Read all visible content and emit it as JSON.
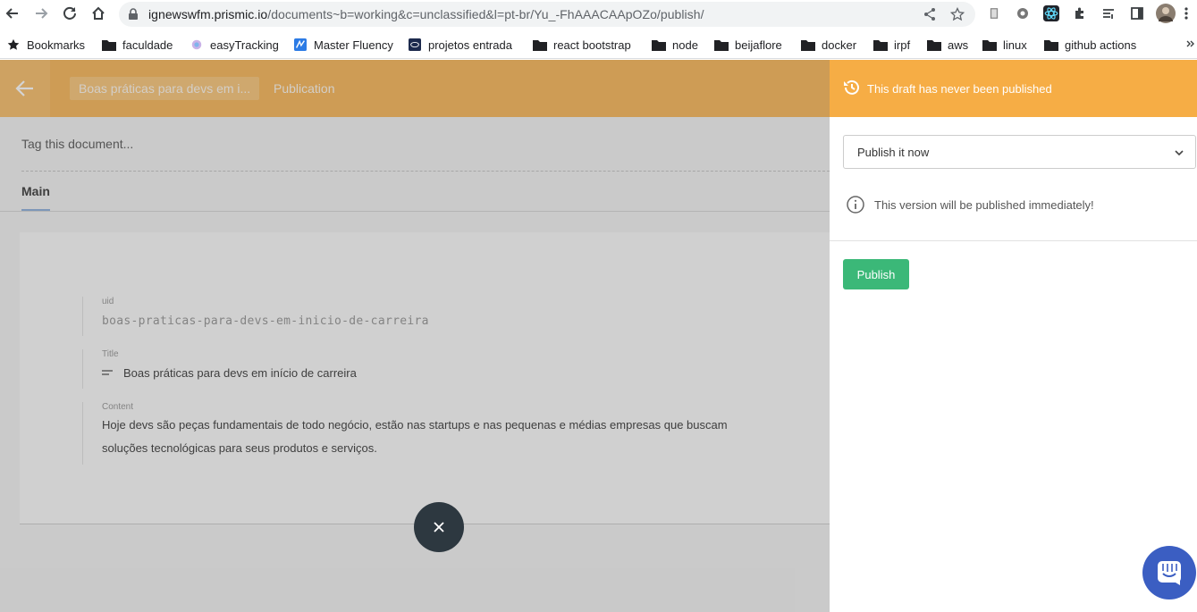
{
  "browser": {
    "url_host": "ignewswfm.prismic.io",
    "url_path": "/documents~b=working&c=unclassified&l=pt-br/Yu_-FhAAACAApOZo/publish/"
  },
  "bookmarks": [
    {
      "label": "Bookmarks",
      "icon": "star-icon"
    },
    {
      "label": "faculdade",
      "icon": "folder-icon"
    },
    {
      "label": "easyTracking",
      "icon": "app-icon"
    },
    {
      "label": "Master Fluency",
      "icon": "app-icon"
    },
    {
      "label": "projetos entrada",
      "icon": "app-icon"
    },
    {
      "label": "react bootstrap",
      "icon": "folder-icon"
    },
    {
      "label": "node",
      "icon": "folder-icon"
    },
    {
      "label": "beijaflore",
      "icon": "folder-icon"
    },
    {
      "label": "docker",
      "icon": "folder-icon"
    },
    {
      "label": "irpf",
      "icon": "folder-icon"
    },
    {
      "label": "aws",
      "icon": "folder-icon"
    },
    {
      "label": "linux",
      "icon": "folder-icon"
    },
    {
      "label": "github actions",
      "icon": "folder-icon"
    }
  ],
  "header": {
    "doc_tab": "Boas práticas para devs em i...",
    "publication_tab": "Publication"
  },
  "tags": {
    "placeholder": "Tag this document..."
  },
  "tabs": {
    "main": "Main"
  },
  "fields": {
    "uid_label": "uid",
    "uid_value": "boas-praticas-para-devs-em-inicio-de-carreira",
    "title_label": "Title",
    "title_value": "Boas práticas para devs em início de carreira",
    "content_label": "Content",
    "content_line1": "Hoje devs são peças fundamentais de todo negócio, estão nas startups e nas pequenas e médias empresas que buscam",
    "content_line2": "soluções tecnológicas para seus produtos e serviços."
  },
  "panel": {
    "status": "This draft has never been published",
    "select_value": "Publish it now",
    "info": "This version will be published immediately!",
    "publish_button": "Publish"
  },
  "colors": {
    "header": "#f6ad45",
    "publish": "#3bb878",
    "chat": "#3b5ec2"
  }
}
